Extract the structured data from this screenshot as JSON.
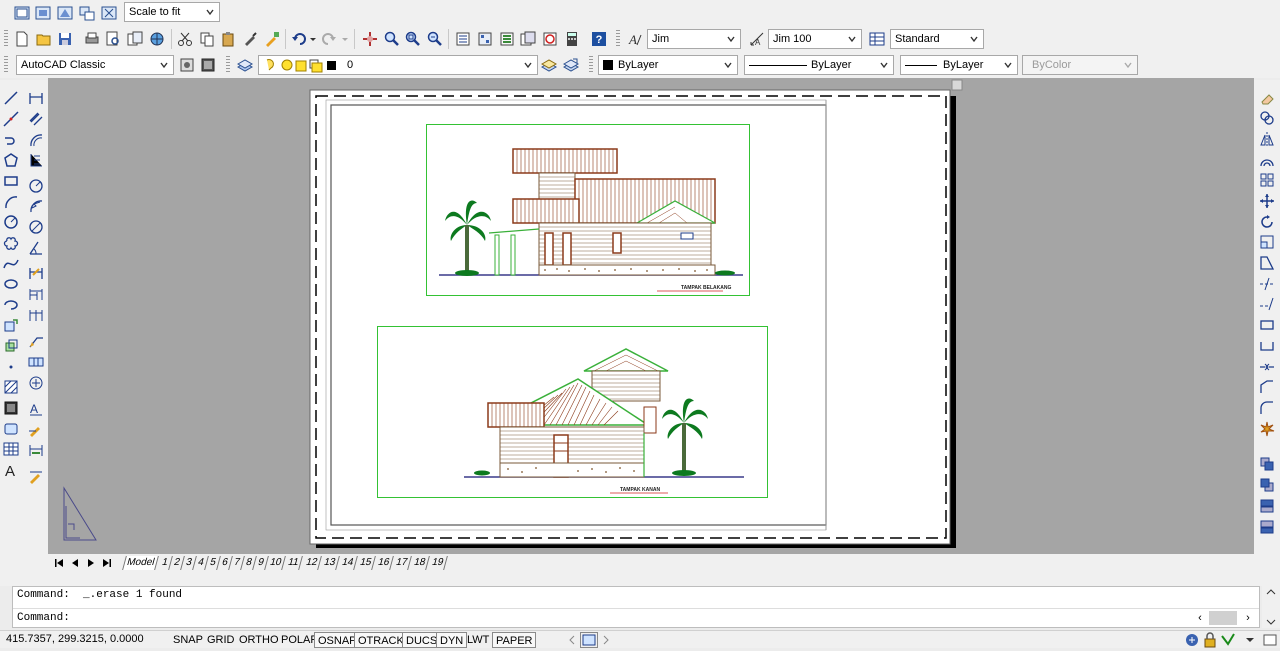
{
  "toolbar1": {
    "zoom_scale": "Scale to fit"
  },
  "toolbar2": {
    "text_style": "Jim",
    "dim_style": "Jim 100",
    "table_style": "Standard"
  },
  "toolbar3": {
    "workspace": "AutoCAD Classic",
    "layer": "0",
    "color": "ByLayer",
    "linetype": "ByLayer",
    "lineweight": "ByLayer",
    "plotstyle": "ByColor"
  },
  "drawing": {
    "top_view_caption": "TAMPAK BELAKANG",
    "bottom_view_caption": "TAMPAK KANAN"
  },
  "layout_tabs": [
    "Model",
    "1",
    "2",
    "3",
    "4",
    "5",
    "6",
    "7",
    "8",
    "9",
    "10",
    "11",
    "12",
    "13",
    "14",
    "15",
    "16",
    "17",
    "18",
    "19"
  ],
  "command": {
    "history_line": "Command:  _.erase 1 found",
    "prompt": "Command:"
  },
  "status": {
    "coords": "415.7357, 299.3215, 0.0000",
    "buttons": [
      "SNAP",
      "GRID",
      "ORTHO",
      "POLAR",
      "OSNAP",
      "OTRACK",
      "DUCS",
      "DYN",
      "LWT",
      "PAPER"
    ],
    "active": [
      "OSNAP",
      "OTRACK",
      "DUCS",
      "DYN",
      "PAPER"
    ]
  },
  "colors": {
    "canvas_bg": "#a5a5a5",
    "viewport_border": "#34c234",
    "roof": "#8b3a1a",
    "wall": "#7a5a3a",
    "tree": "#0d7a1f"
  }
}
